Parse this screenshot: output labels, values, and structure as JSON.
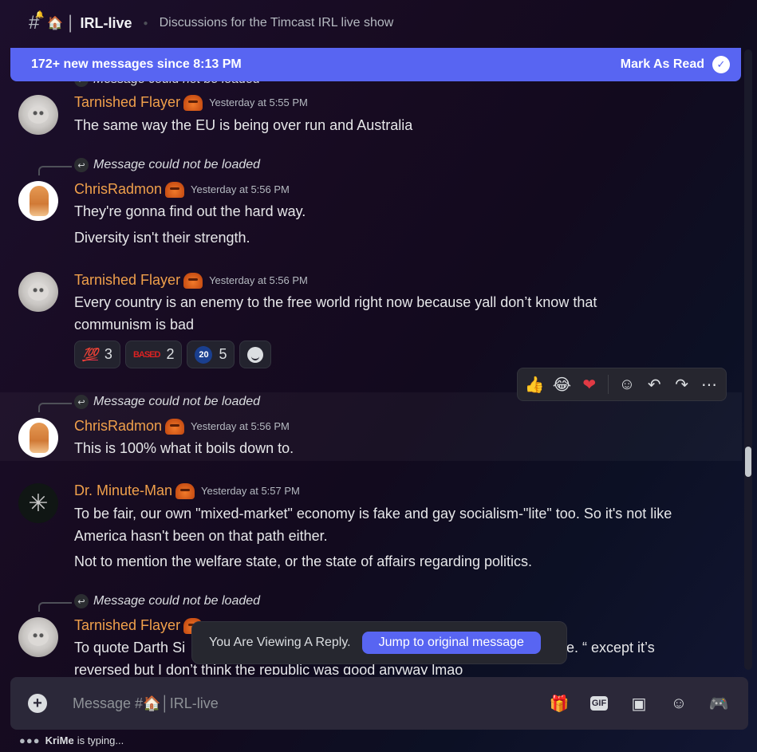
{
  "header": {
    "channel_name": "IRL-live",
    "topic": "Discussions for the Timcast IRL live show"
  },
  "new_messages_bar": {
    "text": "172+ new messages since 8:13 PM",
    "mark_read_label": "Mark As Read"
  },
  "messages": [
    {
      "reply_text": "Message could not be loaded",
      "username": "Tarnished Flayer",
      "timestamp": "Yesterday at 5:55 PM",
      "lines": [
        "The same way the EU is being over run and Australia"
      ]
    },
    {
      "reply_text": "Message could not be loaded",
      "username": "ChrisRadmon",
      "timestamp": "Yesterday at 5:56 PM",
      "lines": [
        "They're gonna find out the hard way.",
        "Diversity isn't their strength."
      ]
    },
    {
      "username": "Tarnished Flayer",
      "timestamp": "Yesterday at 5:56 PM",
      "lines": [
        "Every country is an enemy to the free world right now because yall don’t know that communism is bad"
      ]
    },
    {
      "reply_text": "Message could not be loaded",
      "username": "ChrisRadmon",
      "timestamp": "Yesterday at 5:56 PM",
      "lines": [
        "This is 100% what it boils down to."
      ]
    },
    {
      "username": "Dr. Minute-Man",
      "timestamp": "Yesterday at 5:57 PM",
      "lines": [
        "To be fair, our own \"mixed-market\" economy is fake and gay socialism-\"lite\" too. So it's not like America hasn't been on that path either.",
        "Not to mention the welfare state, or the state of affairs regarding politics."
      ]
    },
    {
      "reply_text": "Message could not be loaded",
      "username": "Tarnished Flayer",
      "line1_start": "To quote Darth Si",
      "line1_end": "e. “ except it’s",
      "line2": "reversed but I don’t think the republic was good anyway lmao"
    }
  ],
  "reactions": [
    {
      "emoji": "💯",
      "count": "3"
    },
    {
      "emoji": "BASED",
      "count": "2"
    },
    {
      "emoji": "20",
      "count": "5"
    }
  ],
  "jump_bar": {
    "label": "You Are Viewing A Reply.",
    "button": "Jump to original message"
  },
  "composer": {
    "placeholder": "Message #🏠│IRL-live"
  },
  "typing": {
    "user": "KriMe",
    "text": "is typing..."
  }
}
